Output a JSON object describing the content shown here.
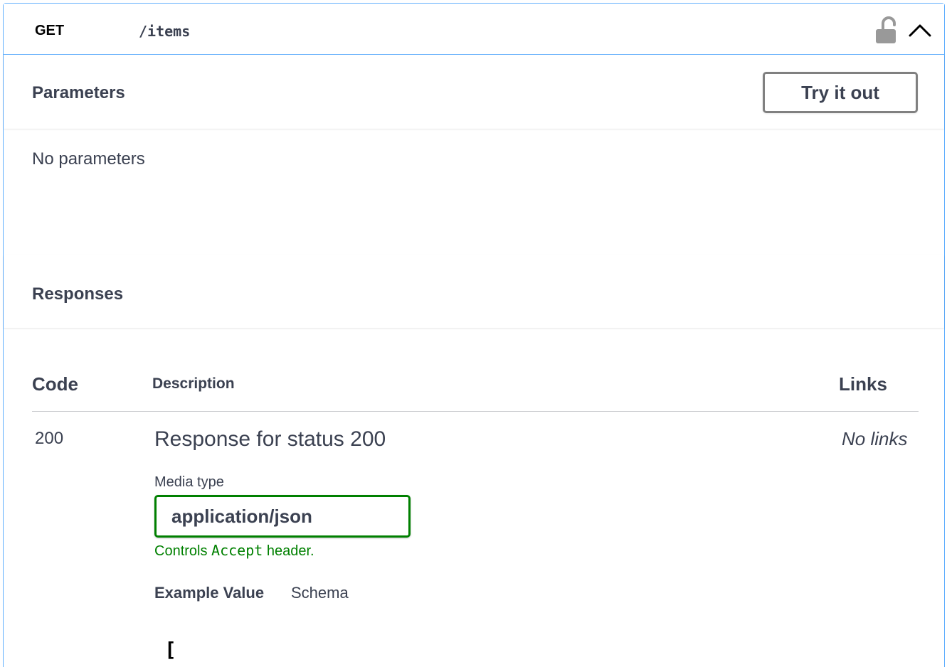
{
  "operation": {
    "method": "GET",
    "path": "/items"
  },
  "parameters": {
    "title": "Parameters",
    "try_button": "Try it out",
    "empty_text": "No parameters"
  },
  "responses": {
    "title": "Responses",
    "columns": {
      "code": "Code",
      "description": "Description",
      "links": "Links"
    },
    "rows": [
      {
        "code": "200",
        "description": "Response for status 200",
        "links": "No links",
        "media_type_label": "Media type",
        "media_type_value": "application/json",
        "controls_prefix": "Controls",
        "controls_code": "Accept",
        "controls_suffix": "header.",
        "tab_example": "Example Value",
        "tab_schema": "Schema",
        "example_code": "["
      }
    ]
  },
  "icons": {
    "lock": "lock-open-icon",
    "collapse": "chevron-up-icon"
  },
  "colors": {
    "get_accent": "#61affe",
    "green": "#008000"
  }
}
